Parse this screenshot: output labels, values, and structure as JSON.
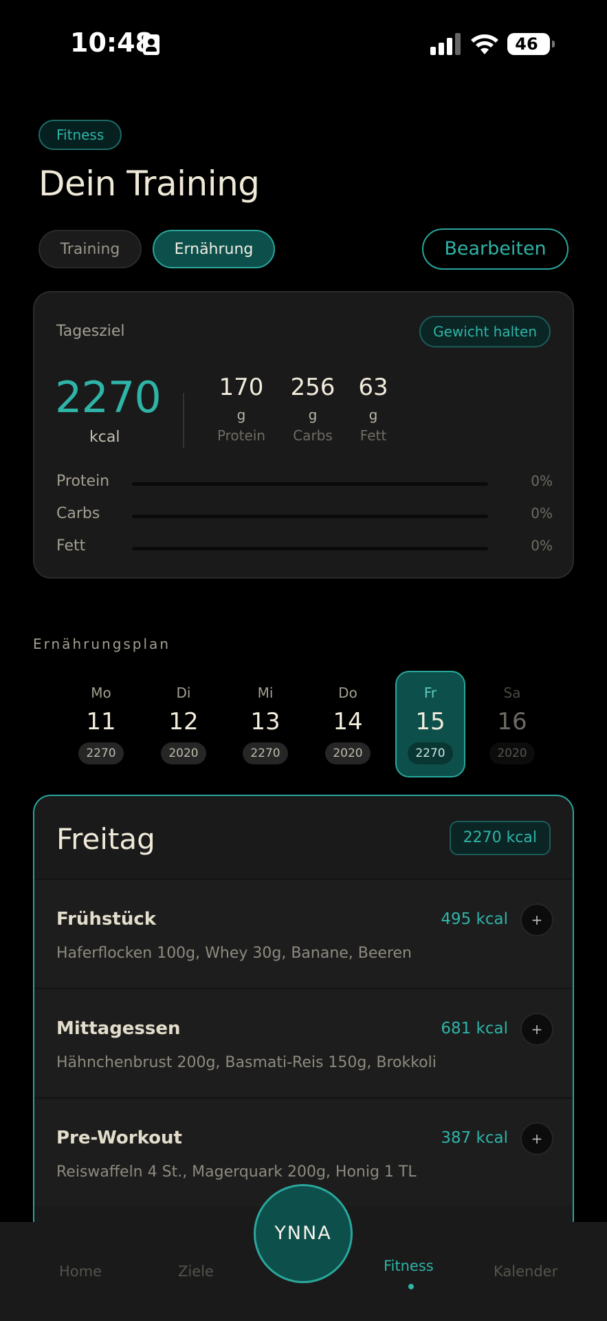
{
  "status_bar": {
    "time": "10:48",
    "battery": "46"
  },
  "header": {
    "category": "Fitness",
    "title": "Dein Training",
    "tabs": [
      {
        "label": "Training"
      },
      {
        "label": "Ernährung"
      }
    ],
    "edit_label": "Bearbeiten"
  },
  "daily_goal": {
    "label": "Tagesziel",
    "mode": "Gewicht halten",
    "kcal": "2270",
    "kcal_unit": "kcal",
    "macros": [
      {
        "value": "170",
        "unit": "g",
        "name": "Protein"
      },
      {
        "value": "256",
        "unit": "g",
        "name": "Carbs"
      },
      {
        "value": "63",
        "unit": "g",
        "name": "Fett"
      }
    ],
    "progress": [
      {
        "label": "Protein",
        "percent": 0,
        "percent_label": "0%"
      },
      {
        "label": "Carbs",
        "percent": 0,
        "percent_label": "0%"
      },
      {
        "label": "Fett",
        "percent": 0,
        "percent_label": "0%"
      }
    ]
  },
  "plan": {
    "label": "Ernährungsplan",
    "days": [
      {
        "name": "Mo",
        "num": "11",
        "kcal": "2270"
      },
      {
        "name": "Di",
        "num": "12",
        "kcal": "2020"
      },
      {
        "name": "Mi",
        "num": "13",
        "kcal": "2270"
      },
      {
        "name": "Do",
        "num": "14",
        "kcal": "2020"
      },
      {
        "name": "Fr",
        "num": "15",
        "kcal": "2270",
        "selected": true
      },
      {
        "name": "Sa",
        "num": "16",
        "kcal": "2020"
      }
    ]
  },
  "day_detail": {
    "title": "Freitag",
    "kcal": "2270 kcal",
    "meals": [
      {
        "name": "Frühstück",
        "kcal": "495 kcal",
        "desc": "Haferflocken 100g, Whey 30g, Banane, Beeren"
      },
      {
        "name": "Mittagessen",
        "kcal": "681 kcal",
        "desc": "Hähnchenbrust 200g, Basmati-Reis 150g, Brokkoli"
      },
      {
        "name": "Pre-Workout",
        "kcal": "387 kcal",
        "desc": "Reiswaffeln 4 St., Magerquark 200g, Honig 1 TL"
      }
    ],
    "add_symbol": "+"
  },
  "nav": {
    "items": [
      {
        "label": "Home"
      },
      {
        "label": "Ziele"
      },
      {
        "label": "Fitness"
      },
      {
        "label": "Kalender"
      }
    ],
    "center_label": "YNNA"
  },
  "colors": {
    "accent": "#2fb4a8",
    "accent_dark": "#0d4f4b",
    "background": "#000000",
    "card": "#1a1a1a"
  }
}
